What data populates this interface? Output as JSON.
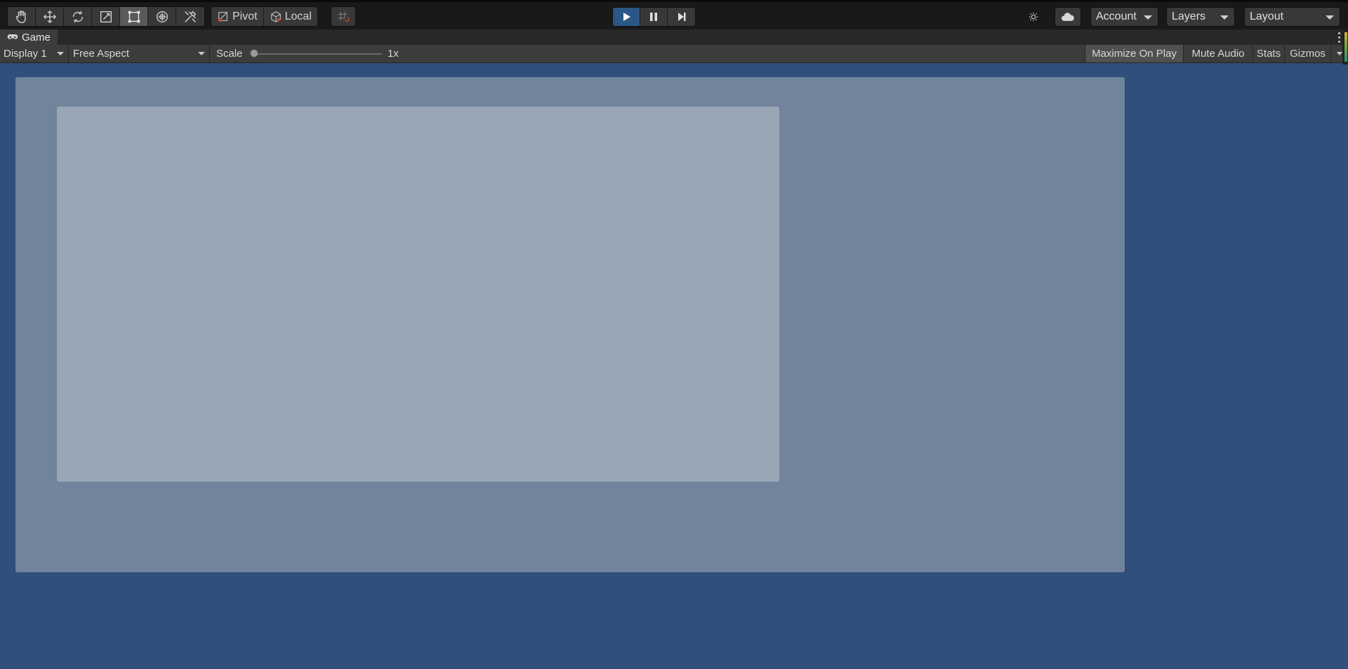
{
  "toolbar": {
    "transform_tools": [
      {
        "icon": "hand-icon"
      },
      {
        "icon": "move-icon"
      },
      {
        "icon": "rotate-icon"
      },
      {
        "icon": "scale-icon"
      },
      {
        "icon": "rect-tool-icon",
        "active": true
      },
      {
        "icon": "transform-icon"
      },
      {
        "icon": "custom-tools-icon"
      }
    ],
    "pivot_label": "Pivot",
    "local_label": "Local",
    "grid_snap_icon": "grid-snap-icon",
    "play_icon": "play-icon",
    "pause_icon": "pause-icon",
    "step_icon": "step-icon",
    "services_icon": "services-icon",
    "cloud_icon": "cloud-icon",
    "account_label": "Account",
    "layers_label": "Layers",
    "layout_label": "Layout",
    "play_active_color": "#2a5786"
  },
  "tab": {
    "label": "Game",
    "icon": "gamepad-icon"
  },
  "game_toolbar": {
    "display": "Display 1",
    "aspect": "Free Aspect",
    "scale_label": "Scale",
    "scale_value": "1x",
    "maximize_label": "Maximize On Play",
    "mute_label": "Mute Audio",
    "stats_label": "Stats",
    "gizmos_label": "Gizmos"
  },
  "colors": {
    "game_background": "#304f7a",
    "outer_panel": "#72839c",
    "inner_panel": "#98a5b5"
  }
}
